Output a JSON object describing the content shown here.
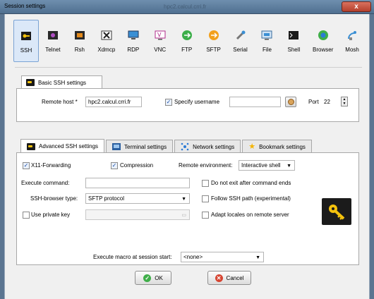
{
  "window": {
    "title": "Session settings",
    "background_title": "hpc2.calcul.crri.fr",
    "close_glyph": "x"
  },
  "session_types": [
    {
      "label": "SSH",
      "icon": "ssh-icon",
      "glyph": "🔑",
      "selected": true
    },
    {
      "label": "Telnet",
      "icon": "telnet-icon",
      "glyph": "▣"
    },
    {
      "label": "Rsh",
      "icon": "rsh-icon",
      "glyph": "⌁"
    },
    {
      "label": "Xdmcp",
      "icon": "xdmcp-icon",
      "glyph": "X"
    },
    {
      "label": "RDP",
      "icon": "rdp-icon",
      "glyph": "▭"
    },
    {
      "label": "VNC",
      "icon": "vnc-icon",
      "glyph": "V"
    },
    {
      "label": "FTP",
      "icon": "ftp-icon",
      "glyph": "●"
    },
    {
      "label": "SFTP",
      "icon": "sftp-icon",
      "glyph": "●"
    },
    {
      "label": "Serial",
      "icon": "serial-icon",
      "glyph": "⟋"
    },
    {
      "label": "File",
      "icon": "file-icon",
      "glyph": "▤"
    },
    {
      "label": "Shell",
      "icon": "shell-icon",
      "glyph": "▬"
    },
    {
      "label": "Browser",
      "icon": "browser-icon",
      "glyph": "◉"
    },
    {
      "label": "Mosh",
      "icon": "mosh-icon",
      "glyph": "📡"
    }
  ],
  "basic": {
    "tab_label": "Basic SSH settings",
    "remote_host_label": "Remote host *",
    "remote_host_value": "hpc2.calcul.crri.fr",
    "specify_username_label": "Specify username",
    "specify_username_checked": true,
    "username_value": "",
    "port_label": "Port",
    "port_value": "22"
  },
  "advanced_tabs": [
    {
      "label": "Advanced SSH settings",
      "icon": "keyboard-icon",
      "active": true
    },
    {
      "label": "Terminal settings",
      "icon": "terminal-icon"
    },
    {
      "label": "Network settings",
      "icon": "network-icon"
    },
    {
      "label": "Bookmark settings",
      "icon": "star-icon"
    }
  ],
  "advanced": {
    "x11_label": "X11-Forwarding",
    "x11_checked": true,
    "compression_label": "Compression",
    "compression_checked": true,
    "remote_env_label": "Remote environment:",
    "remote_env_value": "Interactive shell",
    "execute_command_label": "Execute command:",
    "execute_command_value": "",
    "do_not_exit_label": "Do not exit after command ends",
    "browser_type_label": "SSH-browser type:",
    "browser_type_value": "SFTP protocol",
    "follow_ssh_label": "Follow SSH path (experimental)",
    "use_private_key_label": "Use private key",
    "private_key_value": "",
    "adapt_locales_label": "Adapt locales on remote server",
    "macro_label": "Execute macro at session start:",
    "macro_value": "<none>"
  },
  "buttons": {
    "ok_label": "OK",
    "cancel_label": "Cancel"
  },
  "colors": {
    "ok_green": "#3fae49",
    "cancel_red": "#d64532",
    "key_yellow": "#f4c20d",
    "selected_blue": "#dbe8f8"
  }
}
